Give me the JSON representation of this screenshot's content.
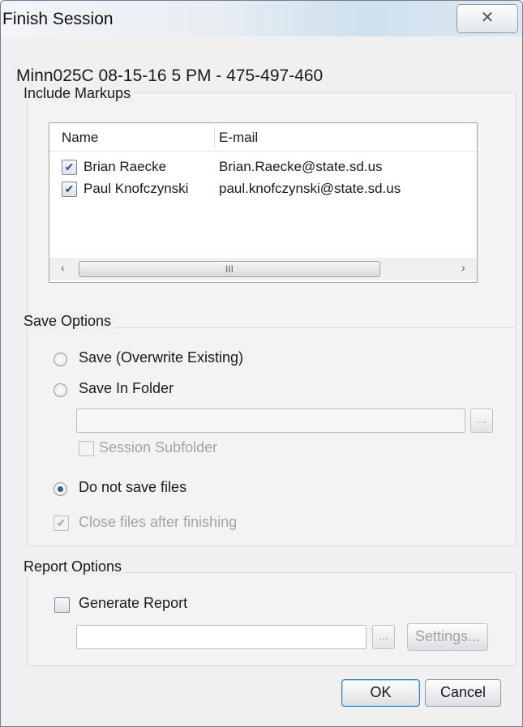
{
  "window": {
    "title": "Finish Session",
    "close_symbol": "✕"
  },
  "session_name": "Minn025C 08-15-16 5 PM - 475-497-460",
  "include_markups": {
    "label": "Include Markups",
    "columns": [
      "Name",
      "E-mail"
    ],
    "rows": [
      {
        "name": "Brian Raecke",
        "email": "Brian.Raecke@state.sd.us",
        "checked": true
      },
      {
        "name": "Paul Knofczynski",
        "email": "paul.knofczynski@state.sd.us",
        "checked": true
      }
    ],
    "scroll_left": "‹",
    "scroll_right": "›",
    "scroll_grip": "III"
  },
  "save_options": {
    "label": "Save Options",
    "overwrite_label": "Save (Overwrite Existing)",
    "folder_label": "Save In Folder",
    "folder_value": "",
    "browse_label": "...",
    "subfolder_label": "Session Subfolder",
    "do_not_save_label": "Do not save files",
    "close_files_label": "Close files after finishing",
    "selected": "do_not_save",
    "close_files_checked": true
  },
  "report_options": {
    "label": "Report Options",
    "generate_label": "Generate Report",
    "generate_checked": false,
    "report_path": "",
    "browse_label": "...",
    "settings_label": "Settings..."
  },
  "buttons": {
    "ok": "OK",
    "cancel": "Cancel"
  }
}
